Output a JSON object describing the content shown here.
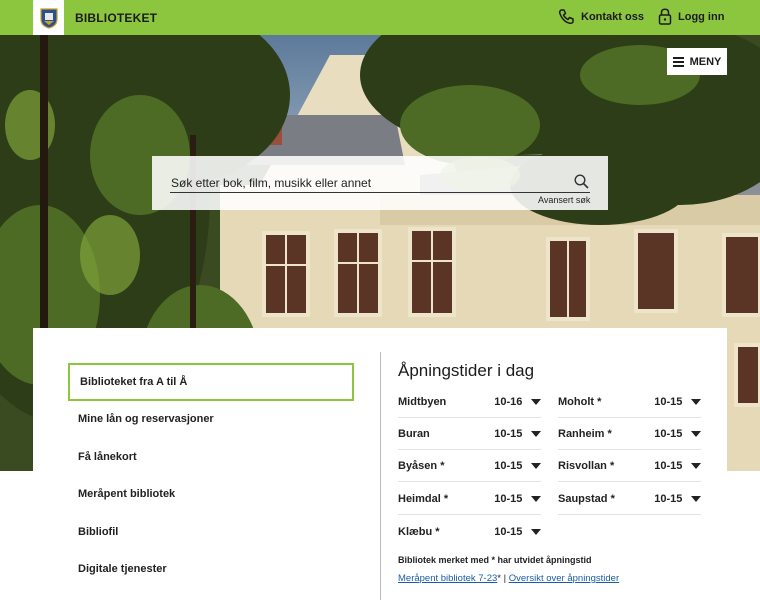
{
  "header": {
    "site_title": "BIBLIOTEKET",
    "contact_label": "Kontakt oss",
    "login_label": "Logg inn",
    "accent": "#8cc63f"
  },
  "hero": {
    "menu_label": "MENY",
    "search_placeholder": "Søk etter bok, film, musikk eller annet",
    "advanced_search": "Avansert søk"
  },
  "nav": {
    "items": [
      "Biblioteket fra A til Å",
      "Mine lån og reservasjoner",
      "Få lånekort",
      "Meråpent bibliotek",
      "Bibliofil",
      "Digitale tjenester"
    ],
    "active_index": 0
  },
  "hours": {
    "title": "Åpningstider i dag",
    "left": [
      {
        "name": "Midtbyen",
        "time": "10-16"
      },
      {
        "name": "Buran",
        "time": "10-15"
      },
      {
        "name": "Byåsen *",
        "time": "10-15"
      },
      {
        "name": "Heimdal *",
        "time": "10-15"
      },
      {
        "name": "Klæbu *",
        "time": "10-15"
      }
    ],
    "right": [
      {
        "name": "Moholt *",
        "time": "10-15"
      },
      {
        "name": "Ranheim *",
        "time": "10-15"
      },
      {
        "name": "Risvollan *",
        "time": "10-15"
      },
      {
        "name": "Saupstad *",
        "time": "10-15"
      }
    ],
    "note": "Bibliotek merket med * har utvidet åpningstid",
    "link1": "Meråpent bibliotek 7-23",
    "link1_suffix": "*",
    "separator": "|",
    "link2": "Oversikt over åpningstider"
  }
}
